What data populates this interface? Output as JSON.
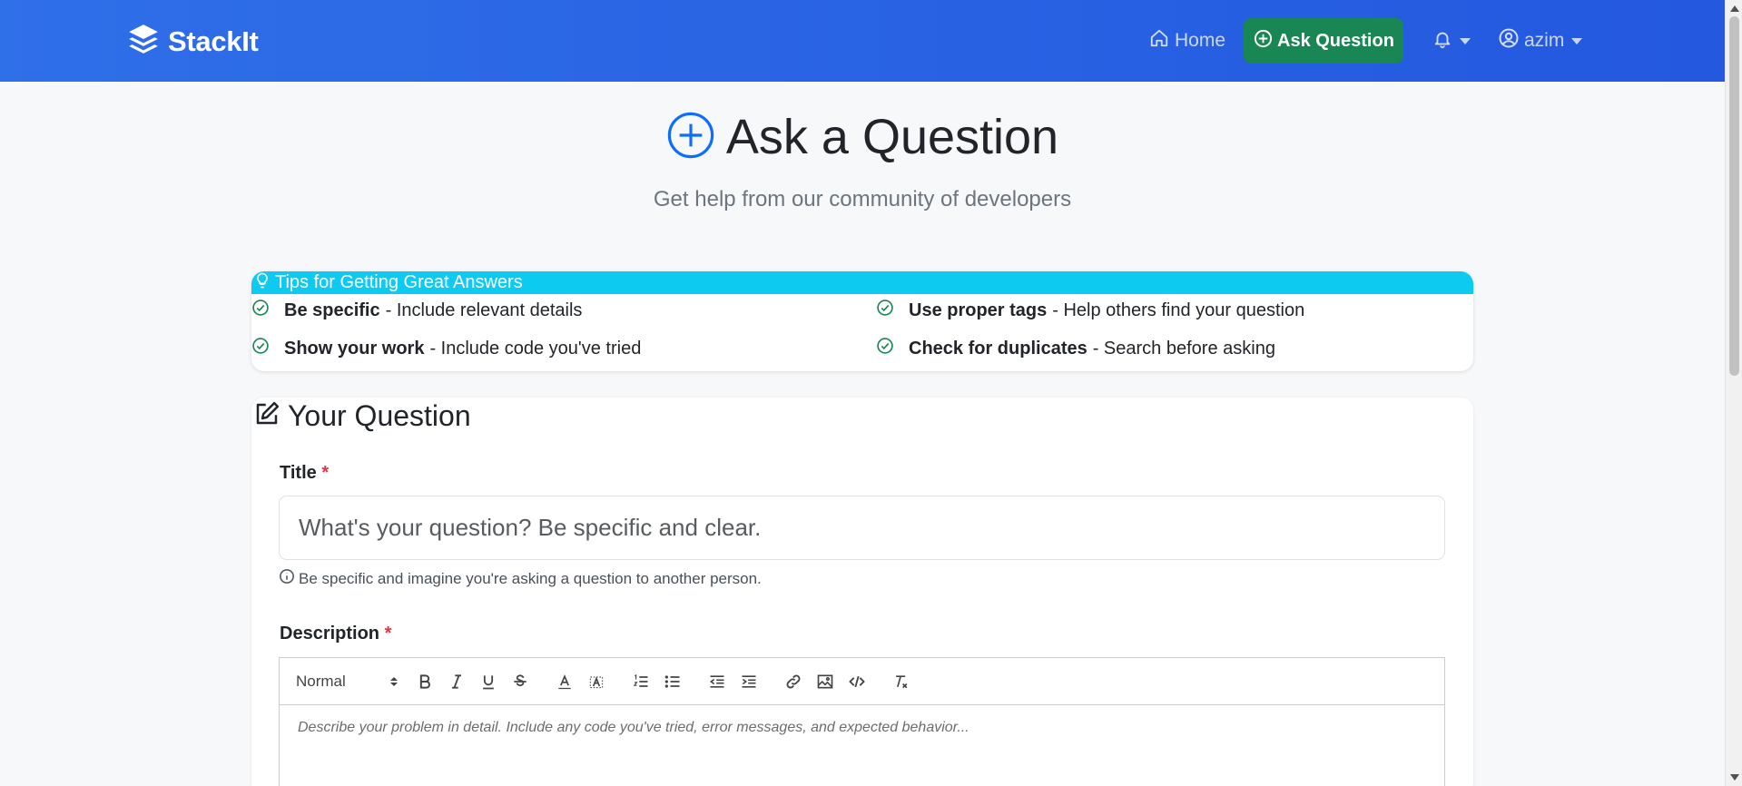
{
  "navbar": {
    "brand": "StackIt",
    "home_label": "Home",
    "ask_label": "Ask Question",
    "user_label": "azim"
  },
  "header": {
    "title": "Ask a Question",
    "subtitle": "Get help from our community of developers"
  },
  "tips": {
    "title": "Tips for Getting Great Answers",
    "items": [
      {
        "bold": "Be specific",
        "text": "- Include relevant details"
      },
      {
        "bold": "Use proper tags",
        "text": "- Help others find your question"
      },
      {
        "bold": "Show your work",
        "text": "- Include code you've tried"
      },
      {
        "bold": "Check for duplicates",
        "text": "- Search before asking"
      }
    ]
  },
  "form": {
    "heading": "Your Question",
    "title_label": "Title",
    "required_mark": "*",
    "title_placeholder": "What's your question? Be specific and clear.",
    "title_hint": "Be specific and imagine you're asking a question to another person.",
    "description_label": "Description",
    "editor_format": "Normal",
    "description_placeholder": "Describe your problem in detail. Include any code you've tried, error messages, and expected behavior..."
  },
  "colors": {
    "navbar": "#2f6fe8",
    "ask_button": "#198754",
    "tips_header": "#0dcaf0",
    "required": "#dc3545",
    "check": "#198754",
    "accent": "#0d6efd"
  },
  "icons": {
    "brand": "layers-icon",
    "home": "house-icon",
    "ask": "plus-circle-icon",
    "notifications": "bell-icon",
    "user": "person-circle-icon",
    "tips": "lightbulb-icon",
    "tip_check": "check-circle-icon",
    "form": "pencil-square-icon",
    "hint": "info-circle-icon"
  }
}
